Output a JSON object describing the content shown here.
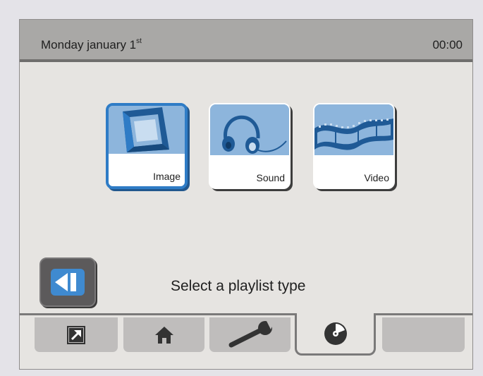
{
  "header": {
    "date": "Monday january 1",
    "date_suffix": "st",
    "time": "00:00"
  },
  "playlist_types": [
    {
      "label": "Image",
      "icon": "picture-frame-icon",
      "selected": true
    },
    {
      "label": "Sound",
      "icon": "headphones-icon",
      "selected": false
    },
    {
      "label": "Video",
      "icon": "film-strip-icon",
      "selected": false
    }
  ],
  "prompt": "Select a playlist type",
  "back_button": {
    "icon": "back-icon"
  },
  "tabs": [
    {
      "icon": "export-arrow-icon",
      "active": false
    },
    {
      "icon": "home-icon",
      "active": false
    },
    {
      "icon": "wrench-icon",
      "active": false
    },
    {
      "icon": "disc-icon",
      "active": true
    },
    {
      "icon": "",
      "active": false
    }
  ],
  "colors": {
    "accent": "#2f7cc6",
    "tile_picture": "#8db5dc",
    "header": "#a9a8a6",
    "background": "#e6e4e1"
  }
}
